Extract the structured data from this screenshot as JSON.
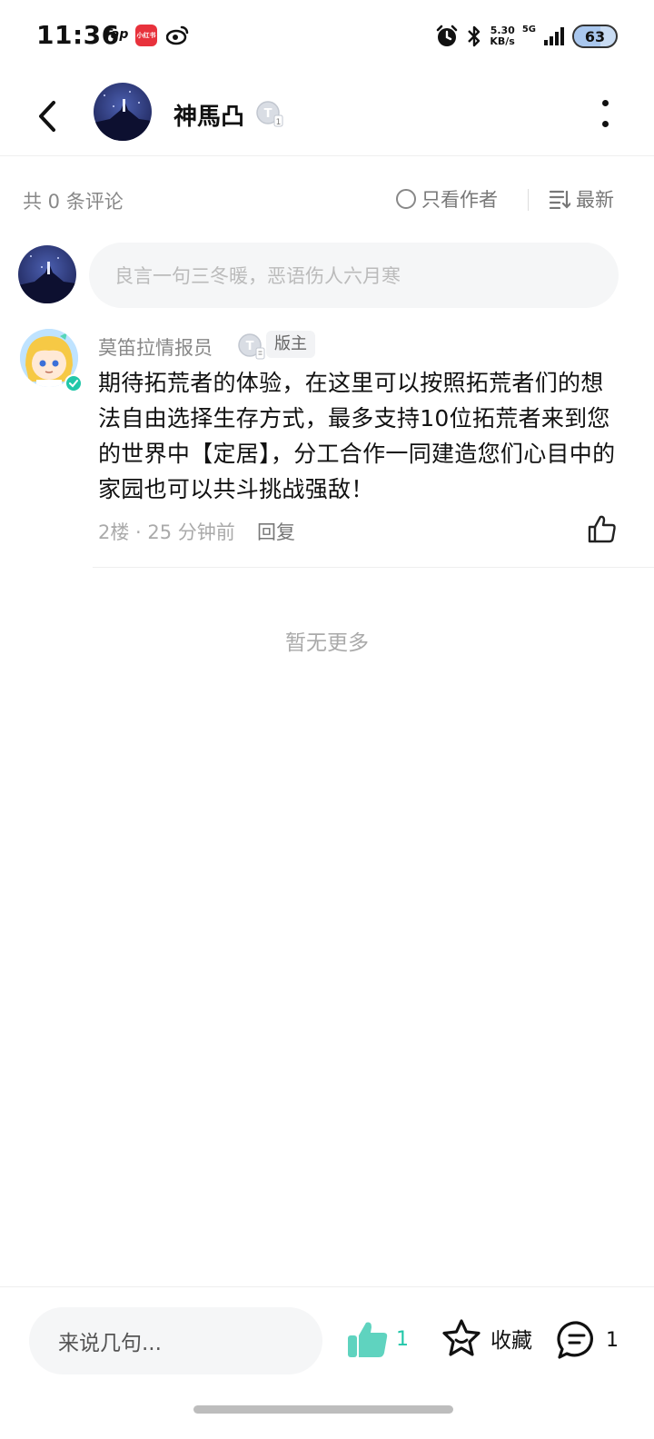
{
  "status_bar": {
    "time": "11:36",
    "app_tap": "Tap",
    "app_xhs": "小红书",
    "net_speed_value": "5.30",
    "net_speed_unit": "KB/s",
    "network": "5G",
    "battery": "63",
    "battery_level_percent": 63
  },
  "header": {
    "username": "神馬凸",
    "level_badge": "T1"
  },
  "filter": {
    "count_label": "共 0 条评论",
    "only_author": "只看作者",
    "sort": "最新"
  },
  "compose": {
    "placeholder": "良言一句三冬暖，恶语伤人六月寒"
  },
  "comment": {
    "username": "莫笛拉情报员",
    "role": "版主",
    "body": "期待拓荒者的体验，在这里可以按照拓荒者们的想法自由选择生存方式，最多支持10位拓荒者来到您的世界中【定居】，分工合作一同建造您们心目中的家园也可以共斗挑战强敌！",
    "meta": "2楼 · 25 分钟前",
    "reply": "回复"
  },
  "list_end": "暂无更多",
  "bottom_bar": {
    "input_placeholder": "来说几句...",
    "like_count": "1",
    "favorite_label": "收藏",
    "comment_count": "1"
  },
  "colors": {
    "accent": "#22c7a9",
    "muted_text": "#888888",
    "input_bg": "#f5f6f7"
  }
}
